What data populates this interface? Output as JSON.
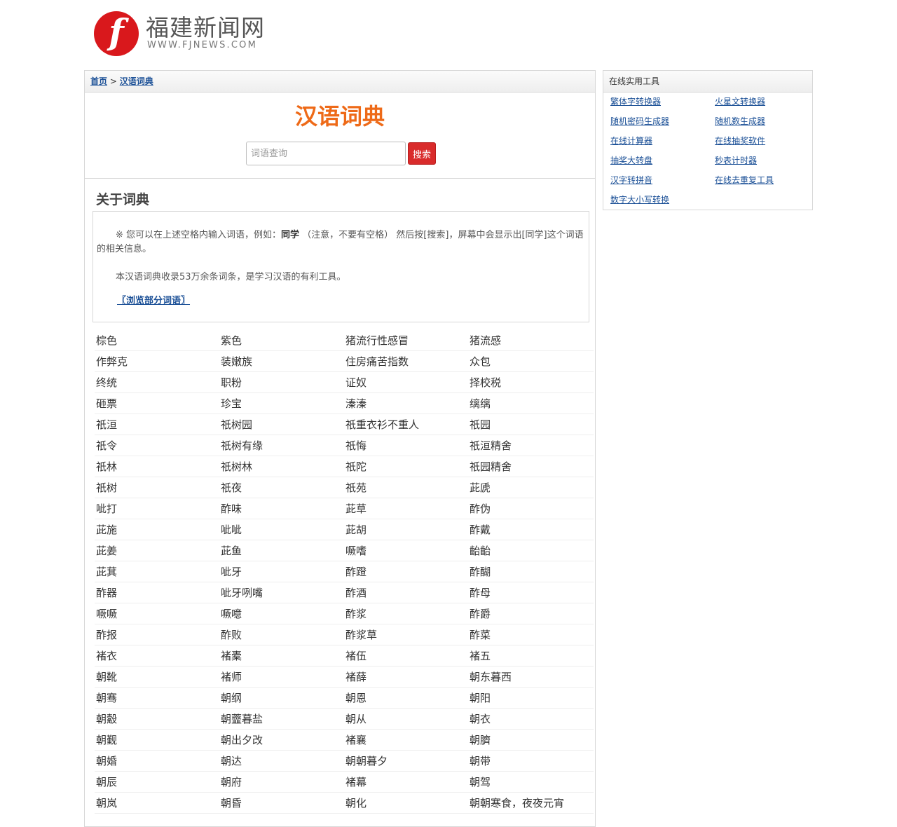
{
  "site": {
    "name": "福建新闻网",
    "url": "WWW.FJNEWS.COM",
    "logo_glyph": "f"
  },
  "breadcrumb": {
    "home": "首页",
    "separator": ">",
    "current": "汉语词典"
  },
  "dictionary": {
    "title": "汉语词典",
    "search_placeholder": "词语查询",
    "search_button": "搜索"
  },
  "about": {
    "heading": "关于词典",
    "p1_before": "※ 您可以在上述空格内输入词语，例如：",
    "p1_example": "同学",
    "p1_after": " （注意，不要有空格） 然后按[搜索]，屏幕中会显示出[同学]这个词语的相关信息。",
    "p2": "本汉语词典收录53万余条词条，是学习汉语的有利工具。",
    "browse_link": "〖浏览部分词语〗"
  },
  "words": [
    "棕色",
    "紫色",
    "猪流行性感冒",
    "猪流感",
    "作弊克",
    "装嫩族",
    "住房痛苦指数",
    "众包",
    "终统",
    "职粉",
    "证奴",
    "择校税",
    "砸票",
    "珍宝",
    "溱溱",
    "缡缡",
    "祇洹",
    "祇树园",
    "祇重衣衫不重人",
    "祇园",
    "祇令",
    "祇树有缘",
    "祇悔",
    "祇洹精舍",
    "祇林",
    "祇树林",
    "祇陀",
    "祇园精舍",
    "祇树",
    "祇夜",
    "祇苑",
    "茈虒",
    "呲打",
    "酢味",
    "茈草",
    "酢伪",
    "茈施",
    "呲呲",
    "茈胡",
    "酢戴",
    "茈姜",
    "茈鱼",
    "噘嗜",
    "齝齝",
    "茈萁",
    "呲牙",
    "酢蹬",
    "酢醐",
    "酢器",
    "呲牙咧嘴",
    "酢酒",
    "酢母",
    "噘噘",
    "噘噫",
    "酢浆",
    "酢爵",
    "酢报",
    "酢败",
    "酢浆草",
    "酢菜",
    "褚衣",
    "褚橐",
    "褚伍",
    "褚五",
    "朝靴",
    "褚师",
    "褚薛",
    "朝东暮西",
    "朝骞",
    "朝纲",
    "朝恩",
    "朝阳",
    "朝觳",
    "朝虀暮盐",
    "朝从",
    "朝衣",
    "朝觐",
    "朝出夕改",
    "褚襄",
    "朝臍",
    "朝婚",
    "朝达",
    "朝朝暮夕",
    "朝带",
    "朝辰",
    "朝府",
    "褚幕",
    "朝驾",
    "朝岚",
    "朝昏",
    "朝化",
    "朝朝寒食，夜夜元宵"
  ],
  "sidebar": {
    "title": "在线实用工具",
    "tools": [
      "繁体字转换器",
      "火星文转换器",
      "随机密码生成器",
      "随机数生成器",
      "在线计算器",
      "在线抽奖软件",
      "抽奖大转盘",
      "秒表计时器",
      "汉字转拼音",
      "在线去重复工具",
      "数字大小写转换"
    ]
  },
  "colors": {
    "accent_orange": "#ee6a18",
    "link_blue": "#1a4f96",
    "button_red": "#d92b2b",
    "logo_red": "#d9181c"
  }
}
